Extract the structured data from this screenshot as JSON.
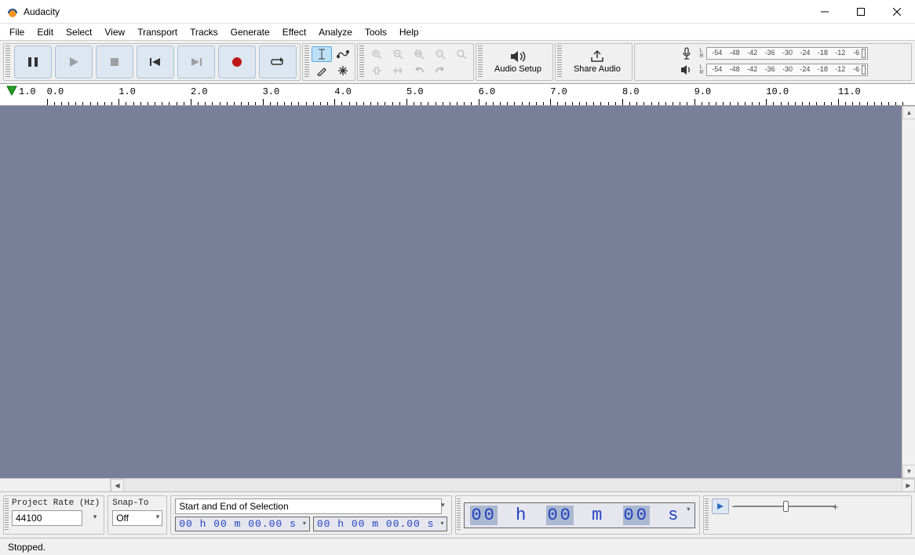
{
  "window": {
    "title": "Audacity"
  },
  "menu": [
    "File",
    "Edit",
    "Select",
    "View",
    "Transport",
    "Tracks",
    "Generate",
    "Effect",
    "Analyze",
    "Tools",
    "Help"
  ],
  "transport": {
    "pause": "Pause",
    "play": "Play",
    "stop": "Stop",
    "skip_start": "Skip to Start",
    "skip_end": "Skip to End",
    "record": "Record",
    "loop": "Loop"
  },
  "big_buttons": {
    "audio_setup": "Audio Setup",
    "share_audio": "Share Audio"
  },
  "meters": {
    "db_labels": [
      "-54",
      "-48",
      "-42",
      "-36",
      "-30",
      "-24",
      "-18",
      "-12",
      "-6"
    ],
    "lr": {
      "l": "L",
      "r": "R"
    }
  },
  "timeline": {
    "start_label": "1.0",
    "ticks": [
      "0.0",
      "1.0",
      "2.0",
      "3.0",
      "4.0",
      "5.0",
      "6.0",
      "7.0",
      "8.0",
      "9.0",
      "10.0",
      "11.0"
    ]
  },
  "bottom": {
    "project_rate_label": "Project Rate (Hz)",
    "project_rate_value": "44100",
    "snap_label": "Snap-To",
    "snap_value": "Off",
    "selection_mode": "Start and End of Selection",
    "time1": "00 h 00 m 00.00 s",
    "time2": "00 h 00 m 00.00 s",
    "big_time_h": "00",
    "big_time_hl": "h",
    "big_time_m": "00",
    "big_time_ml": "m",
    "big_time_s": "00",
    "big_time_sl": "s"
  },
  "status": {
    "text": "Stopped."
  }
}
